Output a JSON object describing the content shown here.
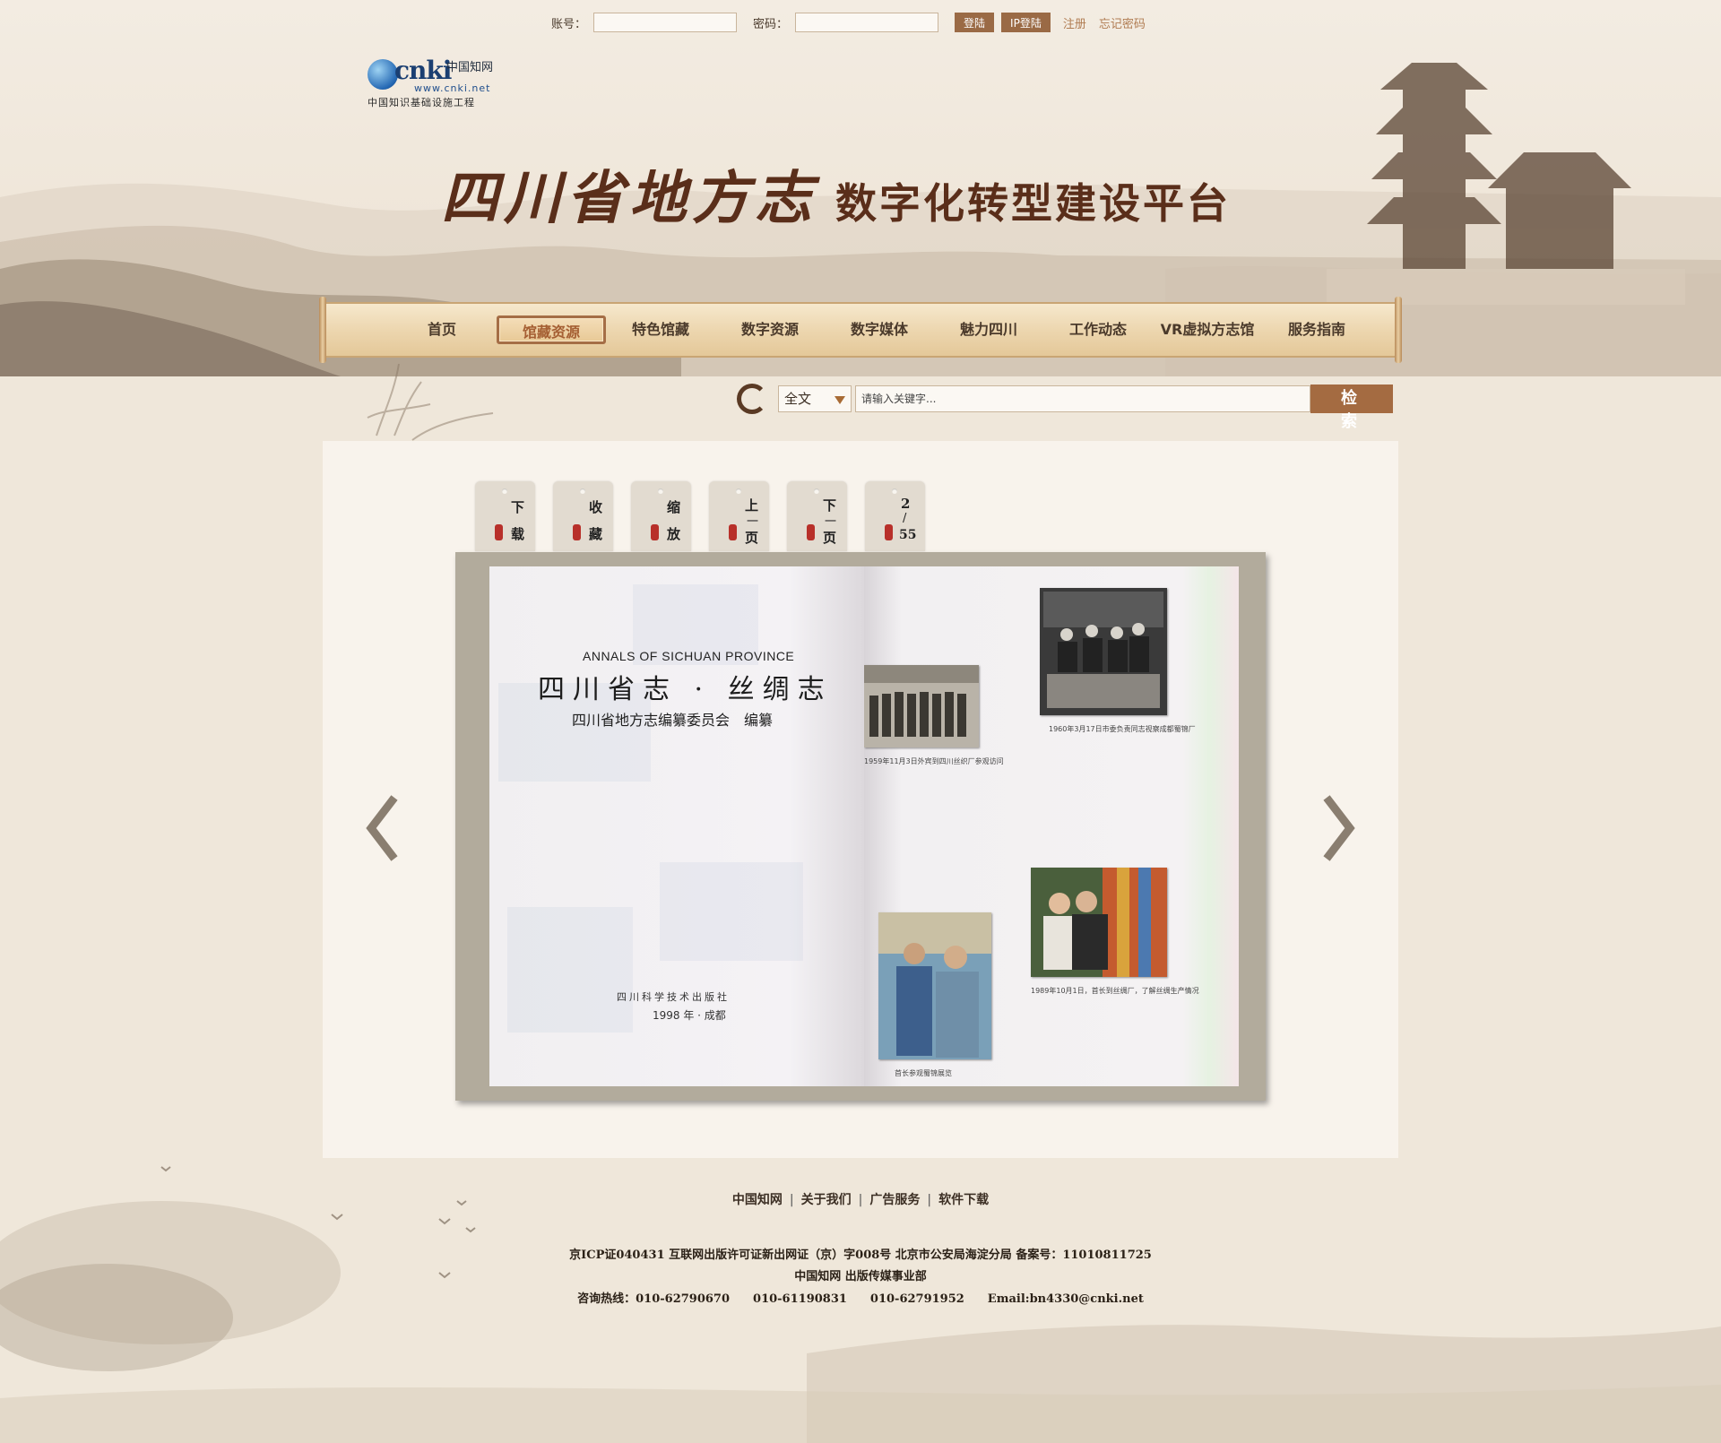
{
  "login": {
    "account_label": "账号：",
    "account_value": "",
    "password_label": "密码：",
    "password_value": "",
    "login_button": "登陆",
    "ip_login_button": "IP登陆",
    "register_link": "注册",
    "forgot_link": "忘记密码"
  },
  "logo": {
    "brand": "cnki",
    "brand_cn": "中国知网",
    "url": "www.cnki.net",
    "tagline": "中国知识基础设施工程"
  },
  "site_title": {
    "part1": "四川省地方志",
    "part2": "数字化转型建设平台"
  },
  "nav": [
    {
      "label": "首页",
      "active": false
    },
    {
      "label": "馆藏资源",
      "active": true
    },
    {
      "label": "特色馆藏",
      "active": false
    },
    {
      "label": "数字资源",
      "active": false
    },
    {
      "label": "数字媒体",
      "active": false
    },
    {
      "label": "魅力四川",
      "active": false
    },
    {
      "label": "工作动态",
      "active": false
    },
    {
      "label": "VR虚拟方志馆",
      "active": false
    },
    {
      "label": "服务指南",
      "active": false
    }
  ],
  "search": {
    "scope_selected": "全文",
    "input_value": "",
    "placeholder": "请输入关键字...",
    "button_label": "检 索"
  },
  "toolbar": {
    "download": [
      "下",
      "载"
    ],
    "favorite": [
      "收",
      "藏"
    ],
    "zoom": [
      "缩",
      "放"
    ],
    "prev_page": [
      "上",
      "一",
      "页"
    ],
    "next_page": [
      "下",
      "一",
      "页"
    ],
    "page_counter": {
      "current": "2",
      "sep": "/",
      "total": "55"
    }
  },
  "book": {
    "left_page": {
      "english_title": "ANNALS OF SICHUAN PROVINCE",
      "chinese_title": "四川省志 · 丝绸志",
      "editor": "四川省地方志编纂委员会　编纂",
      "publisher": "四川科学技术出版社",
      "year_place": "1998 年 · 成都"
    },
    "right_page": {
      "caption_top_right": "1960年3月17日市委负责同志视察成都蜀锦厂",
      "caption_top_left": "1959年11月3日外宾到四川丝织厂参观访问",
      "caption_bottom_right": "1989年10月1日，首长到丝绸厂，了解丝绸生产情况",
      "caption_bottom_left": "首长参观蜀锦展览"
    }
  },
  "footer": {
    "links": [
      "中国知网",
      "关于我们",
      "广告服务",
      "软件下载"
    ],
    "license": "京ICP证040431 互联网出版许可证新出网证（京）字008号 北京市公安局海淀分局 备案号：11010811725",
    "department": "中国知网 出版传媒事业部",
    "hotline": "咨询热线：010-62790670　　010-61190831　　010-62791952　　Email:bn4330@cnki.net"
  },
  "colors": {
    "accent": "#a46b41",
    "nav_bg": "#ecd5ad",
    "page_bg": "#efe7da"
  }
}
